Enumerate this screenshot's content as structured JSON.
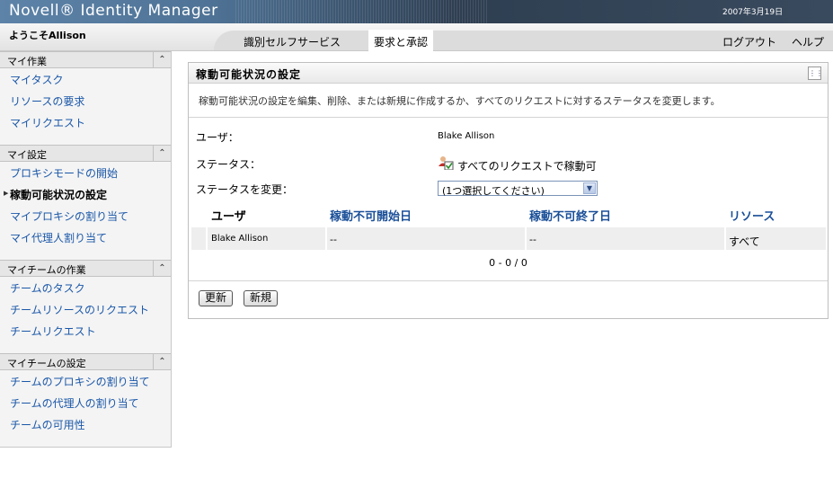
{
  "header": {
    "app_title": "Novell® Identity Manager",
    "date": "2007年3月19日"
  },
  "nav": {
    "welcome": "ようこそAllison",
    "tabs": [
      {
        "label": "識別セルフサービス",
        "selected": false
      },
      {
        "label": "要求と承認",
        "selected": true
      }
    ],
    "logout": "ログアウト",
    "help": "ヘルプ"
  },
  "sidebar": {
    "sections": [
      {
        "title": "マイ作業",
        "items": [
          "マイタスク",
          "リソースの要求",
          "マイリクエスト"
        ]
      },
      {
        "title": "マイ設定",
        "items": [
          "プロキシモードの開始",
          "稼動可能状況の設定",
          "マイプロキシの割り当て",
          "マイ代理人割り当て"
        ],
        "active": "稼動可能状況の設定"
      },
      {
        "title": "マイチームの作業",
        "items": [
          "チームのタスク",
          "チームリソースのリクエスト",
          "チームリクエスト"
        ]
      },
      {
        "title": "マイチームの設定",
        "items": [
          "チームのプロキシの割り当て",
          "チームの代理人の割り当て",
          "チームの可用性"
        ]
      }
    ]
  },
  "panel": {
    "title": "稼動可能状況の設定",
    "description": "稼動可能状況の設定を編集、削除、または新規に作成するか、すべてのリクエストに対するステータスを変更します。",
    "fields": {
      "user_label": "ユーザ：",
      "user_value": "Blake Allison",
      "status_label": "ステータス：",
      "status_value": "すべてのリクエストで稼動可",
      "change_label": "ステータスを変更：",
      "change_select": "(1つ選択してください)"
    },
    "table": {
      "headers": [
        "ユーザ",
        "稼動不可開始日",
        "稼動不可終了日",
        "リソース"
      ],
      "rows": [
        [
          "Blake Allison",
          "--",
          "--",
          "すべて"
        ]
      ],
      "pager": "0 - 0 / 0"
    },
    "buttons": {
      "refresh": "更新",
      "new": "新規"
    }
  },
  "colors": {
    "link": "#1a57a8",
    "header_blue": "#1a4f98"
  }
}
